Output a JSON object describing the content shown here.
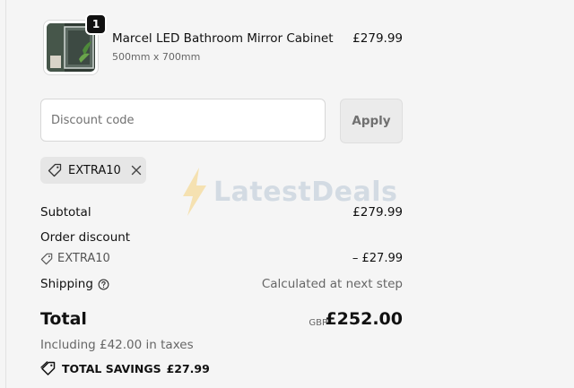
{
  "product": {
    "quantity": "1",
    "name": "Marcel LED Bathroom Mirror Cabinet",
    "variant": "500mm x 700mm",
    "price": "£279.99"
  },
  "discount": {
    "placeholder": "Discount code",
    "apply_label": "Apply",
    "applied_code": "EXTRA10"
  },
  "watermark": "LatestDeals",
  "totals": {
    "subtotal_label": "Subtotal",
    "subtotal_value": "£279.99",
    "order_discount_label": "Order discount",
    "discount_code": "EXTRA10",
    "discount_value": "– £27.99",
    "shipping_label": "Shipping",
    "shipping_value": "Calculated at next step",
    "total_label": "Total",
    "currency": "GBP",
    "total_value": "£252.00",
    "taxes_note": "Including £42.00 in taxes",
    "savings_label": "TOTAL SAVINGS",
    "savings_value": "£27.99"
  },
  "icons": {
    "tag": "tag-icon",
    "close": "close-icon",
    "help": "help-circle-icon",
    "savings": "savings-tag-icon",
    "logo": "bolt-icon"
  }
}
